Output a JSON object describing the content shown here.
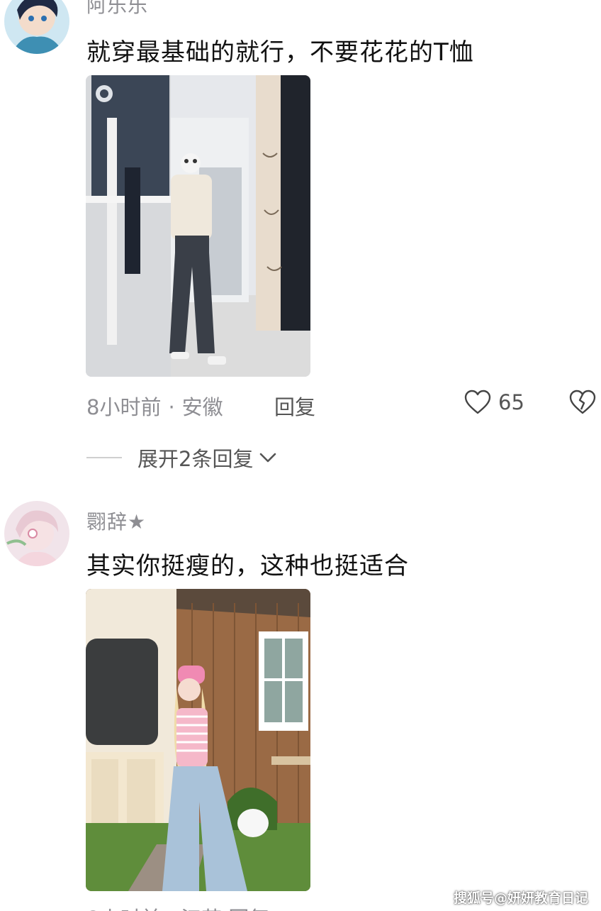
{
  "comments": [
    {
      "username": "阿乐乐",
      "text": "就穿最基础的就行，不要花花的T恤",
      "time": "8小时前",
      "location": "安徽",
      "reply_label": "回复",
      "likes": "65",
      "expand_label": "展开2条回复"
    },
    {
      "username": "翾辞★",
      "text": "其实你挺瘦的，这种也挺适合"
    }
  ],
  "watermark": "搜狐号@妍妍教育日记",
  "icons": [
    "heart-outline-icon",
    "broken-heart-icon",
    "chevron-down-icon"
  ]
}
